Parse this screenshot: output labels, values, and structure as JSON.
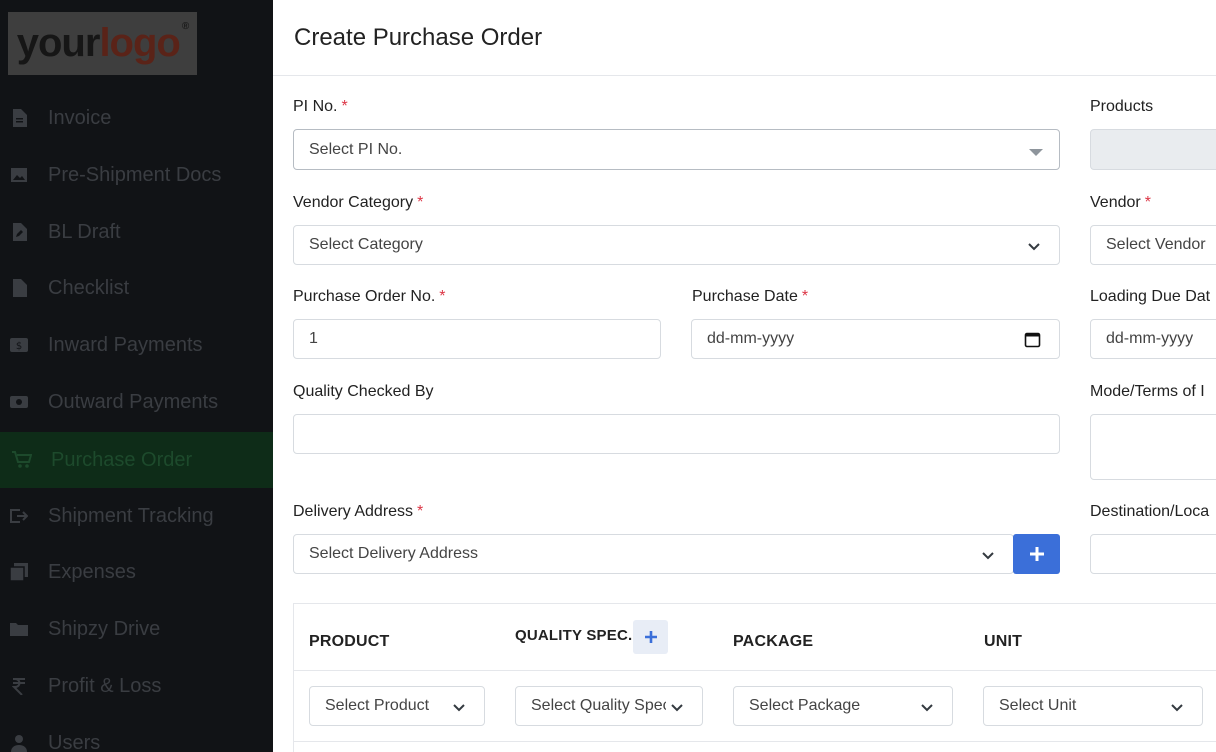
{
  "logo": {
    "text_a": "your",
    "text_b": "logo",
    "mark": "®"
  },
  "sidebar": {
    "items": [
      {
        "label": "Invoice",
        "icon": "file-text-icon"
      },
      {
        "label": "Pre-Shipment Docs",
        "icon": "file-image-icon"
      },
      {
        "label": "BL Draft",
        "icon": "file-edit-icon"
      },
      {
        "label": "Checklist",
        "icon": "file-icon"
      },
      {
        "label": "Inward Payments",
        "icon": "dollar-bill-icon"
      },
      {
        "label": "Outward Payments",
        "icon": "money-icon"
      },
      {
        "label": "Purchase Order",
        "icon": "cart-icon",
        "active": true
      },
      {
        "label": "Shipment Tracking",
        "icon": "exit-icon"
      },
      {
        "label": "Expenses",
        "icon": "copy-icon"
      },
      {
        "label": "Shipzy Drive",
        "icon": "folder-icon"
      },
      {
        "label": "Profit & Loss",
        "icon": "rupee-icon"
      },
      {
        "label": "Users",
        "icon": "user-icon"
      }
    ]
  },
  "page": {
    "title": "Create Purchase Order"
  },
  "form": {
    "pi_no": {
      "label": "PI No.",
      "required": "*",
      "placeholder": "Select PI No."
    },
    "products": {
      "label": "Products",
      "value": ""
    },
    "vendor_category": {
      "label": "Vendor Category",
      "required": "*",
      "value": "Select Category"
    },
    "vendor": {
      "label": "Vendor",
      "required": "*",
      "value": "Select Vendor"
    },
    "po_no": {
      "label": "Purchase Order No.",
      "required": "*",
      "value": "1"
    },
    "purchase_date": {
      "label": "Purchase Date",
      "required": "*",
      "value": "dd-mm-yyyy"
    },
    "loading_due_date": {
      "label": "Loading Due Dat",
      "value": "dd-mm-yyyy"
    },
    "quality_checked_by": {
      "label": "Quality Checked By",
      "value": ""
    },
    "mode_terms": {
      "label": "Mode/Terms of I",
      "value": ""
    },
    "delivery_address": {
      "label": "Delivery Address",
      "required": "*",
      "value": "Select Delivery Address"
    },
    "destination": {
      "label": "Destination/Loca",
      "value": ""
    }
  },
  "table": {
    "headers": {
      "product": "PRODUCT",
      "quality_spec": "QUALITY SPEC.",
      "package": "PACKAGE",
      "unit": "UNIT"
    },
    "row": {
      "product": "Select Product",
      "quality_spec": "Select Quality Spec",
      "package": "Select Package",
      "unit": "Select Unit"
    }
  },
  "colors": {
    "sidebar_bg": "#111316",
    "active_bg": "#0e2c18",
    "accent_blue": "#3b6fd9",
    "required_red": "#dc3545"
  }
}
